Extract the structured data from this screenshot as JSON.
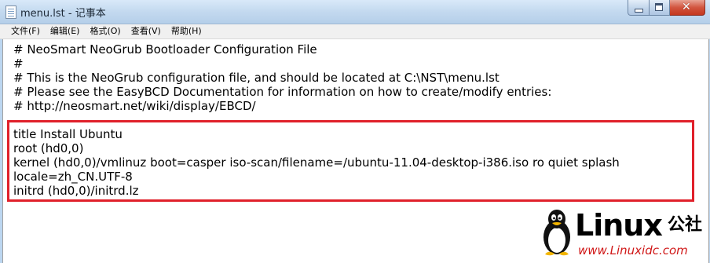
{
  "window": {
    "title": "menu.lst - 记事本",
    "icon": "notepad-icon"
  },
  "caption_buttons": {
    "minimize_icon": "minimize-icon",
    "maximize_icon": "maximize-icon",
    "close_icon": "close-icon",
    "close_glyph": "✕"
  },
  "menu": {
    "items": [
      {
        "label": "文件(F)"
      },
      {
        "label": "编辑(E)"
      },
      {
        "label": "格式(O)"
      },
      {
        "label": "查看(V)"
      },
      {
        "label": "帮助(H)"
      }
    ]
  },
  "document": {
    "lines": [
      "# NeoSmart NeoGrub Bootloader Configuration File",
      "#",
      "# This is the NeoGrub configuration file, and should be located at C:\\NST\\menu.lst",
      "# Please see the EasyBCD Documentation for information on how to create/modify entries:",
      "# http://neosmart.net/wiki/display/EBCD/",
      "",
      "title Install Ubuntu",
      "root (hd0,0)",
      "kernel (hd0,0)/vmlinuz boot=casper iso-scan/filename=/ubuntu-11.04-desktop-i386.iso ro quiet splash",
      "locale=zh_CN.UTF-8",
      "initrd (hd0,0)/initrd.lz"
    ],
    "highlight_color": "#e0202a"
  },
  "watermark": {
    "brand": "Linux",
    "suffix": "公社",
    "url": "www.Linuxidc.com",
    "url_color": "#d01818",
    "logo": "tux-penguin-logo"
  }
}
